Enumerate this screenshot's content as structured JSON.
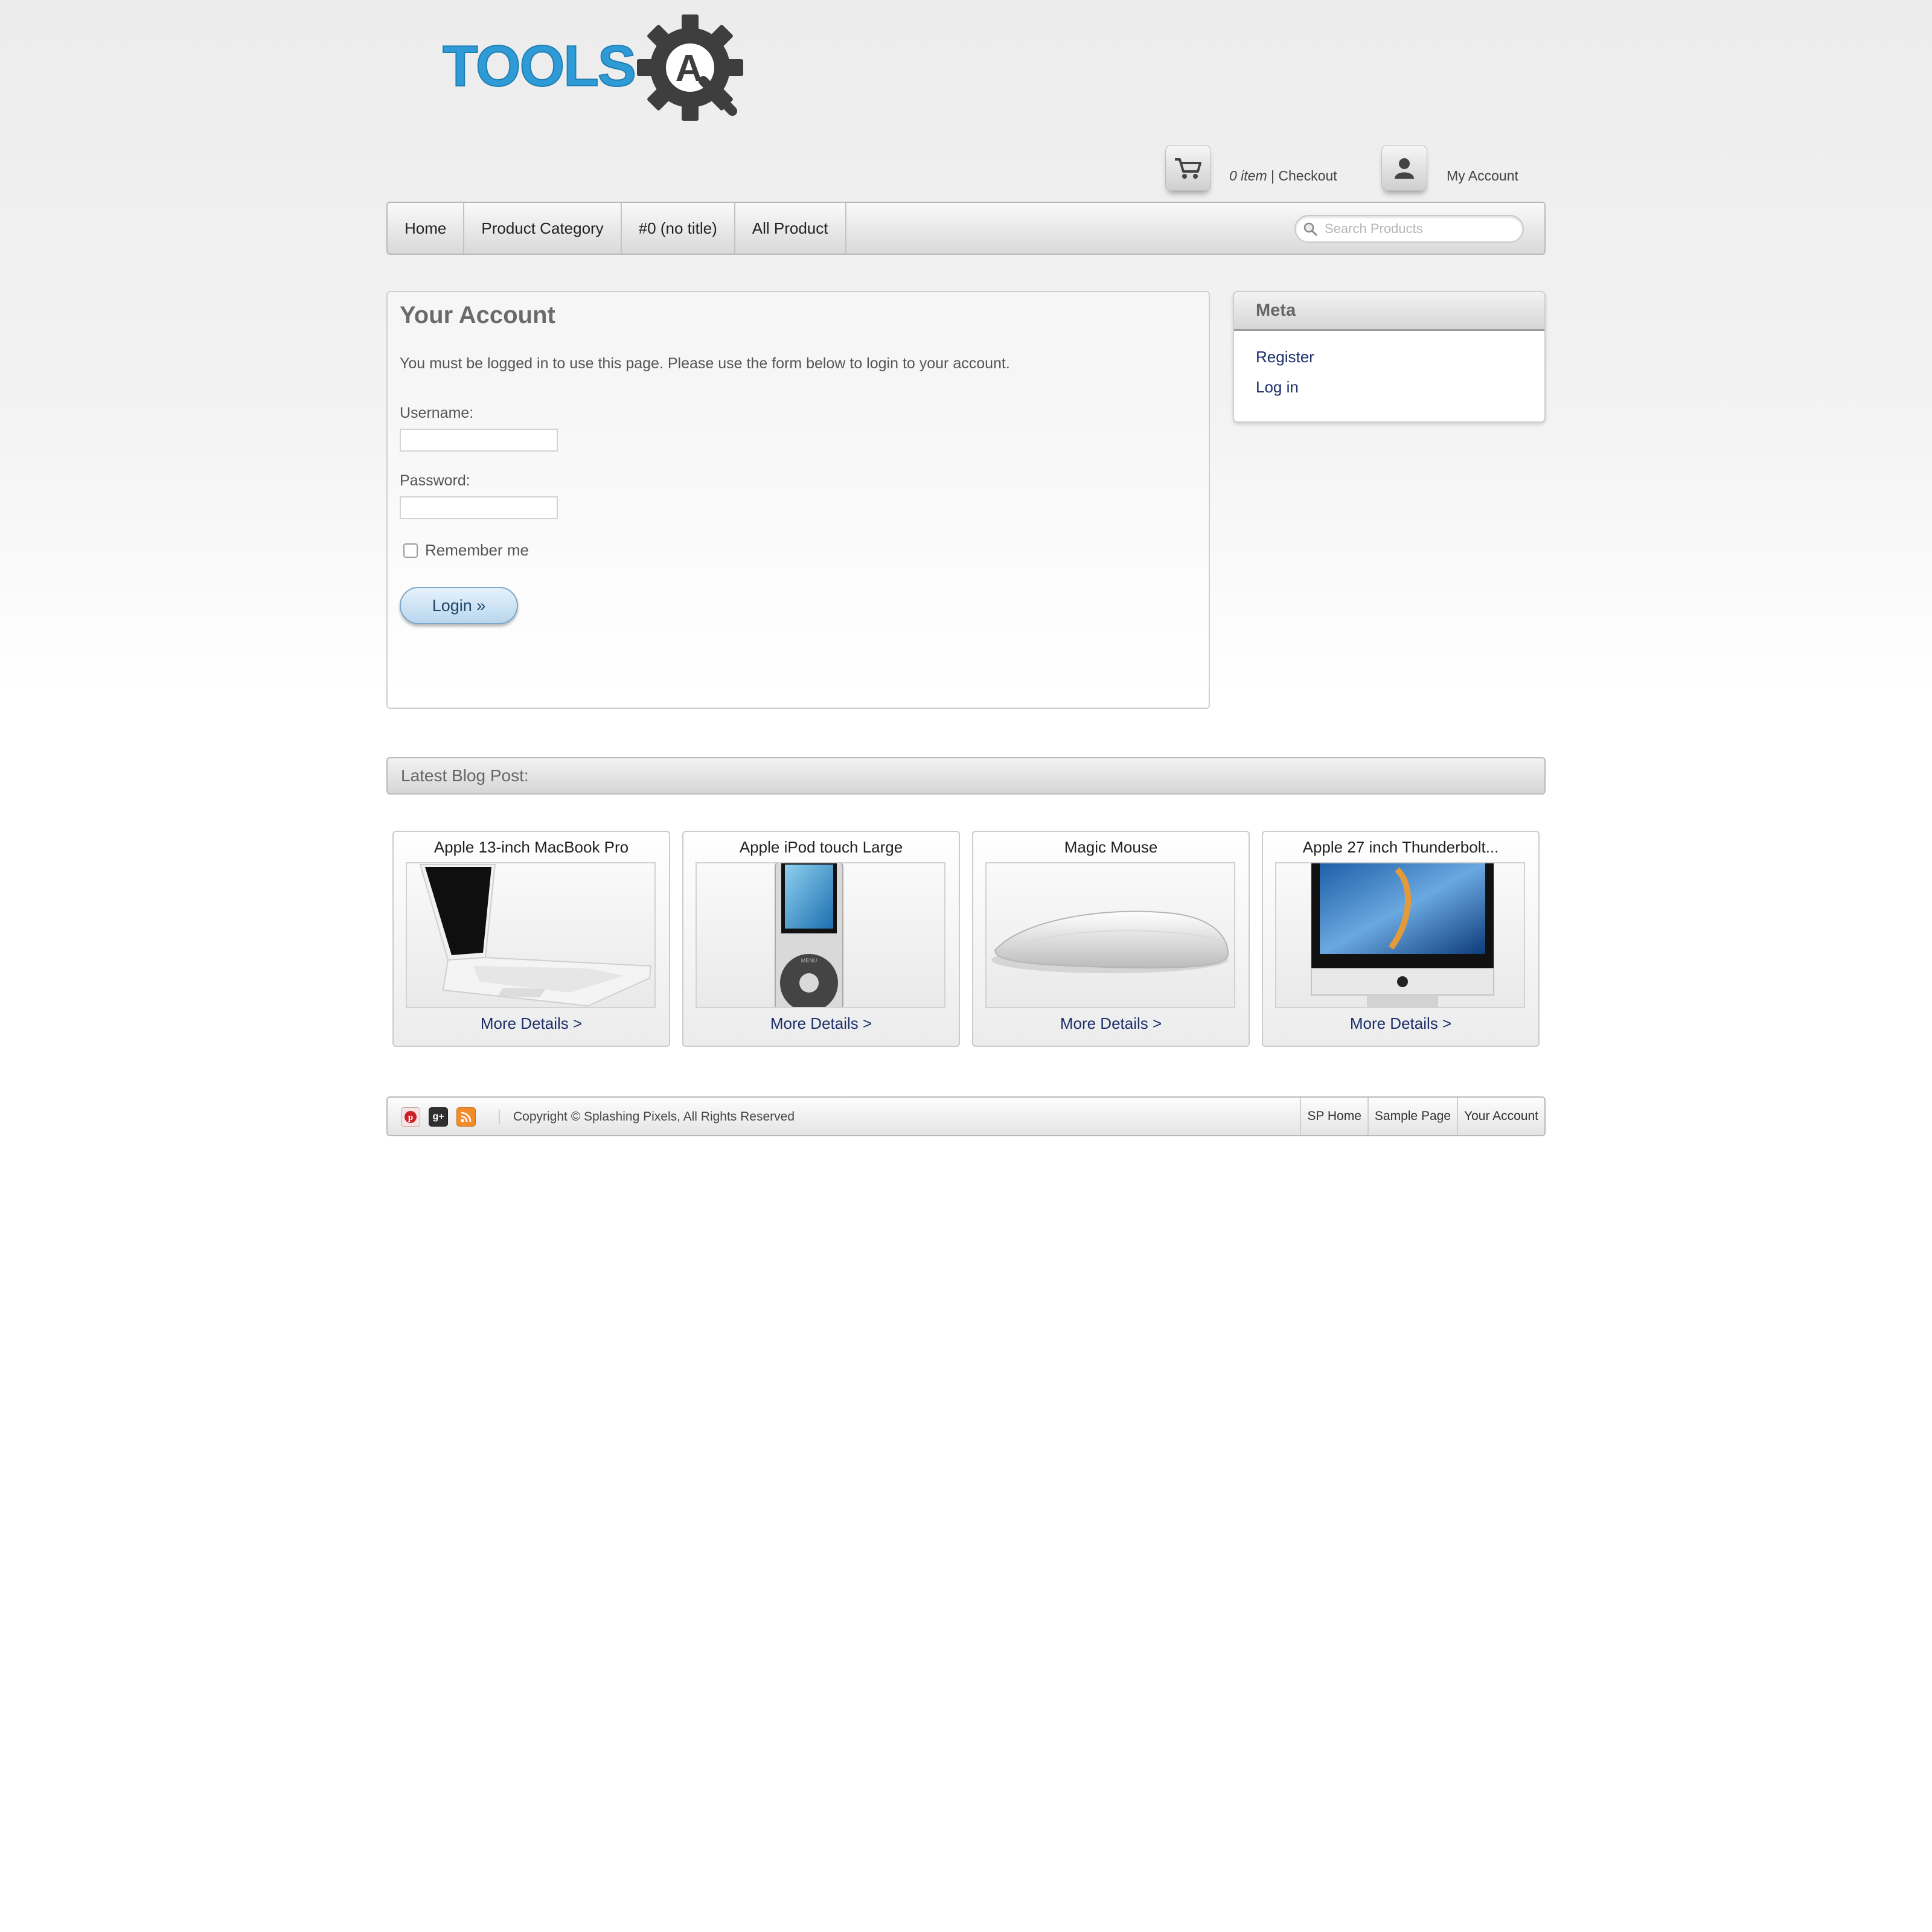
{
  "logo": {
    "text": "TOOLS",
    "emblem_letter": "A",
    "text_color": "#2e9bd6",
    "gear_color": "#3e3e3e"
  },
  "header": {
    "cart_count": "0 item",
    "cart_separator": " | ",
    "checkout_label": "Checkout",
    "my_account_label": "My Account"
  },
  "nav": {
    "items": [
      {
        "label": "Home"
      },
      {
        "label": "Product Category"
      },
      {
        "label": "#0 (no title)"
      },
      {
        "label": "All Product"
      }
    ],
    "search_placeholder": "Search Products"
  },
  "account": {
    "title": "Your Account",
    "message": "You must be logged in to use this page. Please use the form below to login to your account.",
    "username_label": "Username:",
    "password_label": "Password:",
    "remember_label": "Remember me",
    "remember_checked": false,
    "login_label": "Login »"
  },
  "meta": {
    "title": "Meta",
    "links": [
      {
        "label": "Register"
      },
      {
        "label": "Log in"
      }
    ]
  },
  "blog": {
    "title": "Latest Blog Post:"
  },
  "products": [
    {
      "title": "Apple 13-inch MacBook Pro",
      "link": "More Details >",
      "image": "laptop-image"
    },
    {
      "title": "Apple iPod touch Large",
      "link": "More Details >",
      "image": "ipod-image"
    },
    {
      "title": "Magic Mouse",
      "link": "More Details >",
      "image": "mouse-image"
    },
    {
      "title": "Apple 27 inch Thunderbolt...",
      "link": "More Details >",
      "image": "monitor-image"
    }
  ],
  "footer": {
    "social_icons": [
      "pinterest-icon",
      "google-plus-icon",
      "rss-icon"
    ],
    "copyright": "Copyright © Splashing Pixels, All Rights Reserved",
    "links": [
      {
        "label": "SP Home"
      },
      {
        "label": "Sample Page"
      },
      {
        "label": "Your Account"
      }
    ]
  },
  "colors": {
    "link": "#1c2f6b",
    "button_border": "#7aa6c9",
    "button_fill": "#cfe3f3"
  }
}
